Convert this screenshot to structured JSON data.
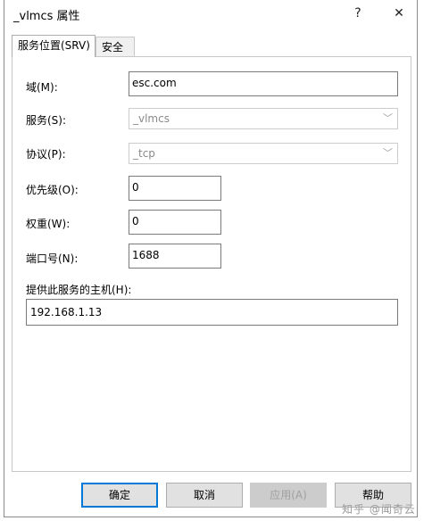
{
  "window": {
    "title": "_vlmcs 属性",
    "help_glyph": "?",
    "close_glyph": "✕"
  },
  "tabs": [
    {
      "label": "服务位置(SRV)",
      "active": true
    },
    {
      "label": "安全",
      "active": false
    }
  ],
  "form": {
    "domain_label": "域(M):",
    "domain_value": "esc.com",
    "service_label": "服务(S):",
    "service_value": "_vlmcs",
    "protocol_label": "协议(P):",
    "protocol_value": "_tcp",
    "priority_label": "优先级(O):",
    "priority_value": "0",
    "weight_label": "权重(W):",
    "weight_value": "0",
    "port_label": "端口号(N):",
    "port_value": "1688",
    "host_label": "提供此服务的主机(H):",
    "host_value": "192.168.1.13"
  },
  "buttons": {
    "ok": "确定",
    "cancel": "取消",
    "apply": "应用(A)",
    "help": "帮助"
  },
  "watermark": "知乎 @闻奇云"
}
